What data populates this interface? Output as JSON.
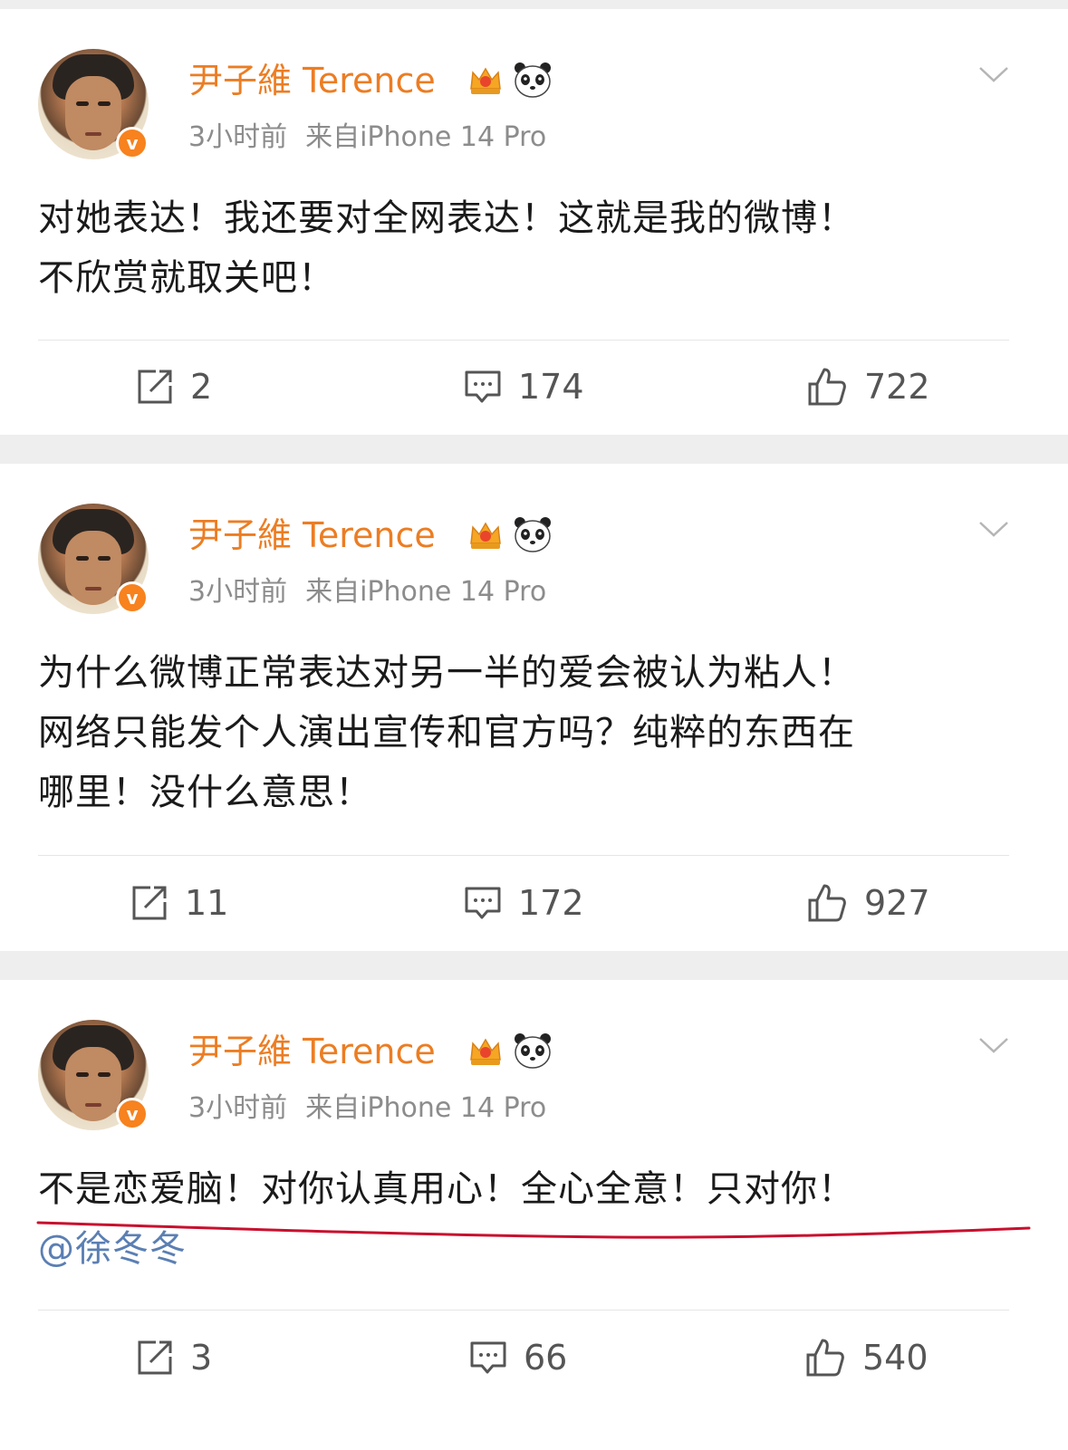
{
  "posts": [
    {
      "username": "尹子維 Terence",
      "time": "3小时前",
      "source": "来自iPhone 14 Pro",
      "verified_label": "v",
      "lines": [
        "对她表达！我还要对全网表达！这就是我的微博！",
        "不欣赏就取关吧！"
      ],
      "mention": "",
      "reposts": "2",
      "comments": "174",
      "likes": "722"
    },
    {
      "username": "尹子維 Terence",
      "time": "3小时前",
      "source": "来自iPhone 14 Pro",
      "verified_label": "v",
      "lines": [
        "为什么微博正常表达对另一半的爱会被认为粘人！",
        "网络只能发个人演出宣传和官方吗？纯粹的东西在",
        "哪里！没什么意思！"
      ],
      "mention": "",
      "reposts": "11",
      "comments": "172",
      "likes": "927"
    },
    {
      "username": "尹子維 Terence",
      "time": "3小时前",
      "source": "来自iPhone 14 Pro",
      "verified_label": "v",
      "lines": [
        "不是恋爱脑！对你认真用心！全心全意！只对你！"
      ],
      "mention": "@徐冬冬",
      "reposts": "3",
      "comments": "66",
      "likes": "540"
    }
  ],
  "colors": {
    "username": "#ec7d23",
    "verified_badge": "#f7821e",
    "meta": "#8c8c8c",
    "mention": "#5b7fb3",
    "annotation_underline": "#c8102e",
    "separator": "#eeeeee"
  },
  "icons": {
    "repost": "repost-icon",
    "comment": "comment-icon",
    "like": "thumbs-up-icon",
    "menu": "chevron-down-icon",
    "crown": "crown-badge-icon",
    "panda": "panda-badge-icon"
  }
}
